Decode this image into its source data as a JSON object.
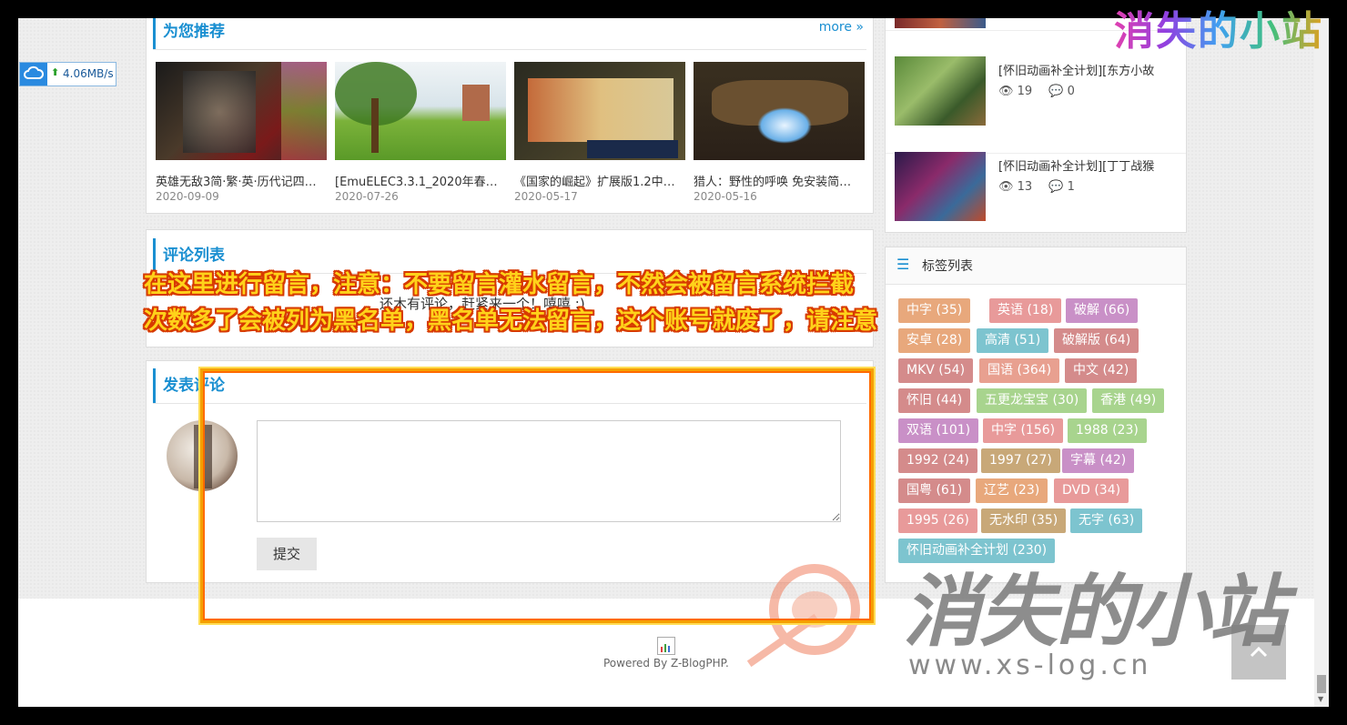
{
  "recommend": {
    "title": "为您推荐",
    "more": "more »",
    "items": [
      {
        "title": "英雄无敌3简·繁·英·历代记四…",
        "date": "2020-09-09"
      },
      {
        "title": "[EmuELEC3.3.1_2020年春…",
        "date": "2020-07-26"
      },
      {
        "title": "《国家的崛起》扩展版1.2中…",
        "date": "2020-05-17"
      },
      {
        "title": "猎人：野性的呼唤 免安装简…",
        "date": "2020-05-16"
      }
    ]
  },
  "comments": {
    "title": "评论列表",
    "empty_text": "还木有评论，赶紧来一个！嘻嘻 :)"
  },
  "post_comment": {
    "title": "发表评论",
    "submit": "提交"
  },
  "sidebar": {
    "items": [
      {
        "title": "[怀旧动画补全计划][东方小故",
        "views": "19",
        "comments": "0"
      },
      {
        "title": "[怀旧动画补全计划][丁丁战猴",
        "views": "13",
        "comments": "1"
      }
    ],
    "tags_title": "标签列表",
    "tags": [
      {
        "label": "中字 (35)",
        "color": "#e8a87c"
      },
      {
        "label": "英语 (18)",
        "color": "#e89a9a"
      },
      {
        "label": "破解 (66)",
        "color": "#c990c7"
      },
      {
        "label": "安卓 (28)",
        "color": "#e8a87c"
      },
      {
        "label": "高清 (51)",
        "color": "#7dc4cf"
      },
      {
        "label": "破解版 (64)",
        "color": "#d48b8b"
      },
      {
        "label": "MKV (54)",
        "color": "#d48b8b"
      },
      {
        "label": "国语 (364)",
        "color": "#e8a090"
      },
      {
        "label": "中文 (42)",
        "color": "#d48b8b"
      },
      {
        "label": "怀旧 (44)",
        "color": "#d48b8b"
      },
      {
        "label": "五更龙宝宝 (30)",
        "color": "#a8d48e"
      },
      {
        "label": "香港 (49)",
        "color": "#a8d48e"
      },
      {
        "label": "双语 (101)",
        "color": "#c990c7"
      },
      {
        "label": "中字 (156)",
        "color": "#e89a9a"
      },
      {
        "label": "1988 (23)",
        "color": "#a8d48e"
      },
      {
        "label": "1992 (24)",
        "color": "#d48b8b"
      },
      {
        "label": "1997 (27)",
        "color": "#c8a878"
      },
      {
        "label": "字幕 (42)",
        "color": "#c990c7"
      },
      {
        "label": "国粤 (61)",
        "color": "#d48b8b"
      },
      {
        "label": "辽艺 (23)",
        "color": "#e8a87c"
      },
      {
        "label": "DVD (34)",
        "color": "#e89a9a"
      },
      {
        "label": "1995 (26)",
        "color": "#e89a9a"
      },
      {
        "label": "无水印 (35)",
        "color": "#c8a878"
      },
      {
        "label": "无字 (63)",
        "color": "#7dc4cf"
      },
      {
        "label": "怀旧动画补全计划 (230)",
        "color": "#7dc4cf"
      }
    ]
  },
  "footer": {
    "powered": "Powered By Z-BlogPHP."
  },
  "speed_widget": {
    "value": "4.06MB/s"
  },
  "annotation": {
    "line1": "在这里进行留言，注意：不要留言灌水留言，不然会被留言系统拦截",
    "line2": "次数多了会被列为黑名单，黑名单无法留言，这个账号就废了，请注意"
  },
  "watermark": {
    "top_text": "消失的小站",
    "big_text": "消失的小站",
    "url": "www.xs-log.cn"
  }
}
